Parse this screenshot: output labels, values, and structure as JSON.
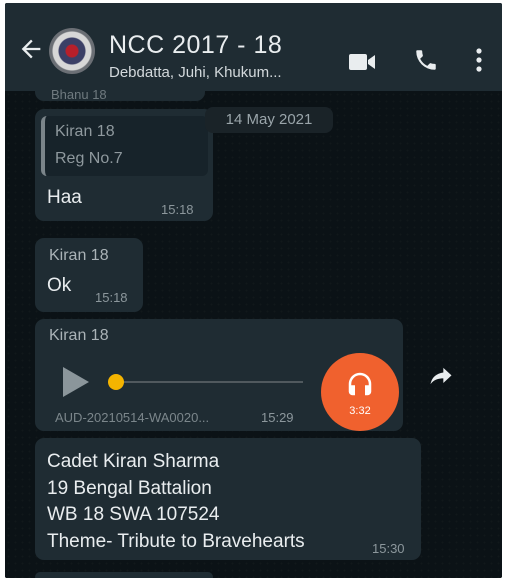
{
  "header": {
    "back_icon": "arrow-left-icon",
    "group_name": "NCC 2017 - 18",
    "members": "Debdatta, Juhi, Khukum..."
  },
  "chat": {
    "partial_text": "Bhanu 18",
    "date_chip": "14 May 2021",
    "messages": [
      {
        "quote_sender": "Kiran 18",
        "quote_text": "Reg No.7",
        "text": "Haa",
        "time": "15:18"
      },
      {
        "sender": "Kiran 18",
        "text": "Ok",
        "time": "15:18"
      },
      {
        "sender": "Kiran 18",
        "type": "audio",
        "filename": "AUD-20210514-WA0020...",
        "duration": "3:32",
        "time": "15:29"
      },
      {
        "lines": [
          "Cadet Kiran Sharma",
          "19 Bengal Battalion",
          "WB 18 SWA 107524",
          "Theme- Tribute to Bravehearts"
        ],
        "time": "15:30"
      }
    ]
  },
  "colors": {
    "header_bg": "#1f2c33",
    "chat_bg": "#0b1216",
    "bubble_bg": "#1f2c33",
    "audio_avatar": "#f0612e",
    "progress_knob": "#f4b400"
  }
}
